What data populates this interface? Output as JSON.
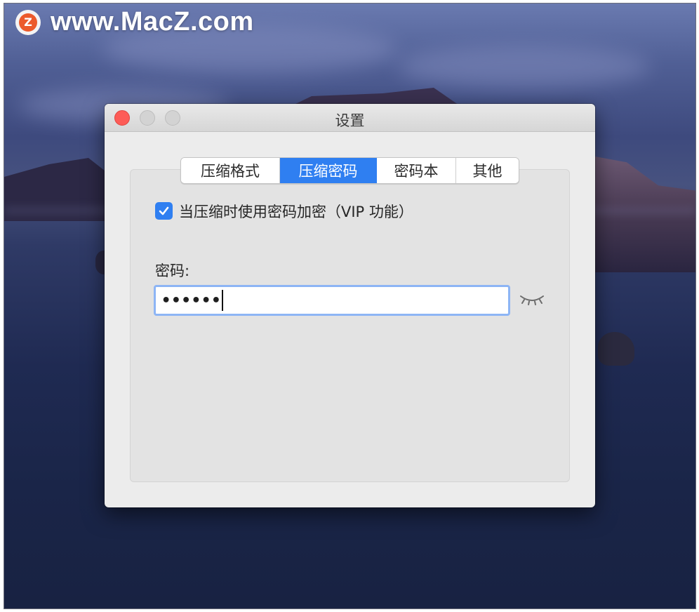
{
  "watermark": {
    "logo_letter": "Z",
    "text": "www.MacZ.com"
  },
  "window": {
    "title": "设置",
    "traffic_lights": [
      "close",
      "minimize",
      "zoom"
    ]
  },
  "tabs": [
    {
      "label": "压缩格式",
      "active": false
    },
    {
      "label": "压缩密码",
      "active": true
    },
    {
      "label": "密码本",
      "active": false
    },
    {
      "label": "其他",
      "active": false
    }
  ],
  "settings": {
    "encrypt_checkbox": {
      "label": "当压缩时使用密码加密（VIP 功能）",
      "checked": true
    },
    "password_label": "密码:",
    "password_mask": "••••••",
    "reveal_icon": "eye-closed-icon"
  },
  "colors": {
    "accent": "#2f7ff1",
    "close": "#fd5c57",
    "focus_ring": "#8db5f5"
  }
}
